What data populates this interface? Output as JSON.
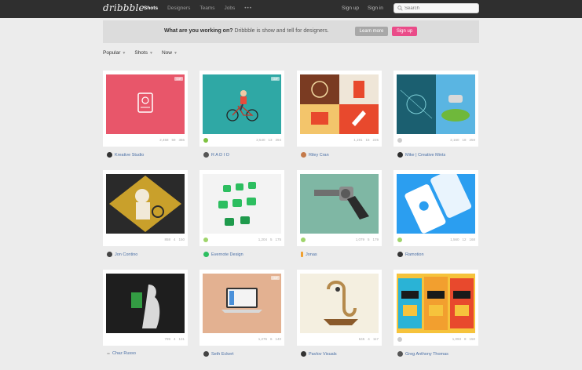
{
  "brand": {
    "logo": "dribbble"
  },
  "nav": {
    "shots": "Shots",
    "designers": "Designers",
    "teams": "Teams",
    "jobs": "Jobs",
    "more": "•••"
  },
  "auth": {
    "signup": "Sign up",
    "signin": "Sign in"
  },
  "search": {
    "placeholder": "Search"
  },
  "banner": {
    "question": "What are you working on?",
    "pitch": "Dribbble is show and tell for designers.",
    "learn_more": "Learn more",
    "signup": "Sign up"
  },
  "filters": {
    "popular": "Popular",
    "shots": "Shots",
    "now": "Now"
  },
  "colors": {
    "accent": "#ea4c89",
    "topbar": "#2f2f2f",
    "link": "#4a6fa5"
  },
  "shots": [
    {
      "author": "Kreative Studio",
      "views": "2,458",
      "comments": "59",
      "likes": "386",
      "gif": "GIF"
    },
    {
      "author": "R A D I O",
      "views": "2,540",
      "comments": "13",
      "likes": "394",
      "gif": "GIF"
    },
    {
      "author": "Riley Cran",
      "views": "1,191",
      "comments": "15",
      "likes": "225"
    },
    {
      "author": "Mike | Creative Mints",
      "views": "2,160",
      "comments": "18",
      "likes": "259"
    },
    {
      "author": "Jon Contino",
      "views": "858",
      "comments": "4",
      "likes": "150"
    },
    {
      "author": "Evernote Design",
      "views": "1,204",
      "comments": "5",
      "likes": "175"
    },
    {
      "author": "Jonas",
      "views": "1,079",
      "comments": "5",
      "likes": "179"
    },
    {
      "author": "Ramotion",
      "views": "1,560",
      "comments": "12",
      "likes": "168"
    },
    {
      "author": "Chaz Russo",
      "views": "799",
      "comments": "4",
      "likes": "131"
    },
    {
      "author": "Seth Eckert",
      "views": "1,276",
      "comments": "6",
      "likes": "140",
      "gif": "GIF"
    },
    {
      "author": "Pavlov Visuals",
      "views": "645",
      "comments": "4",
      "likes": "117"
    },
    {
      "author": "Greg Anthony Thomas",
      "views": "1,093",
      "comments": "8",
      "likes": "150"
    }
  ]
}
